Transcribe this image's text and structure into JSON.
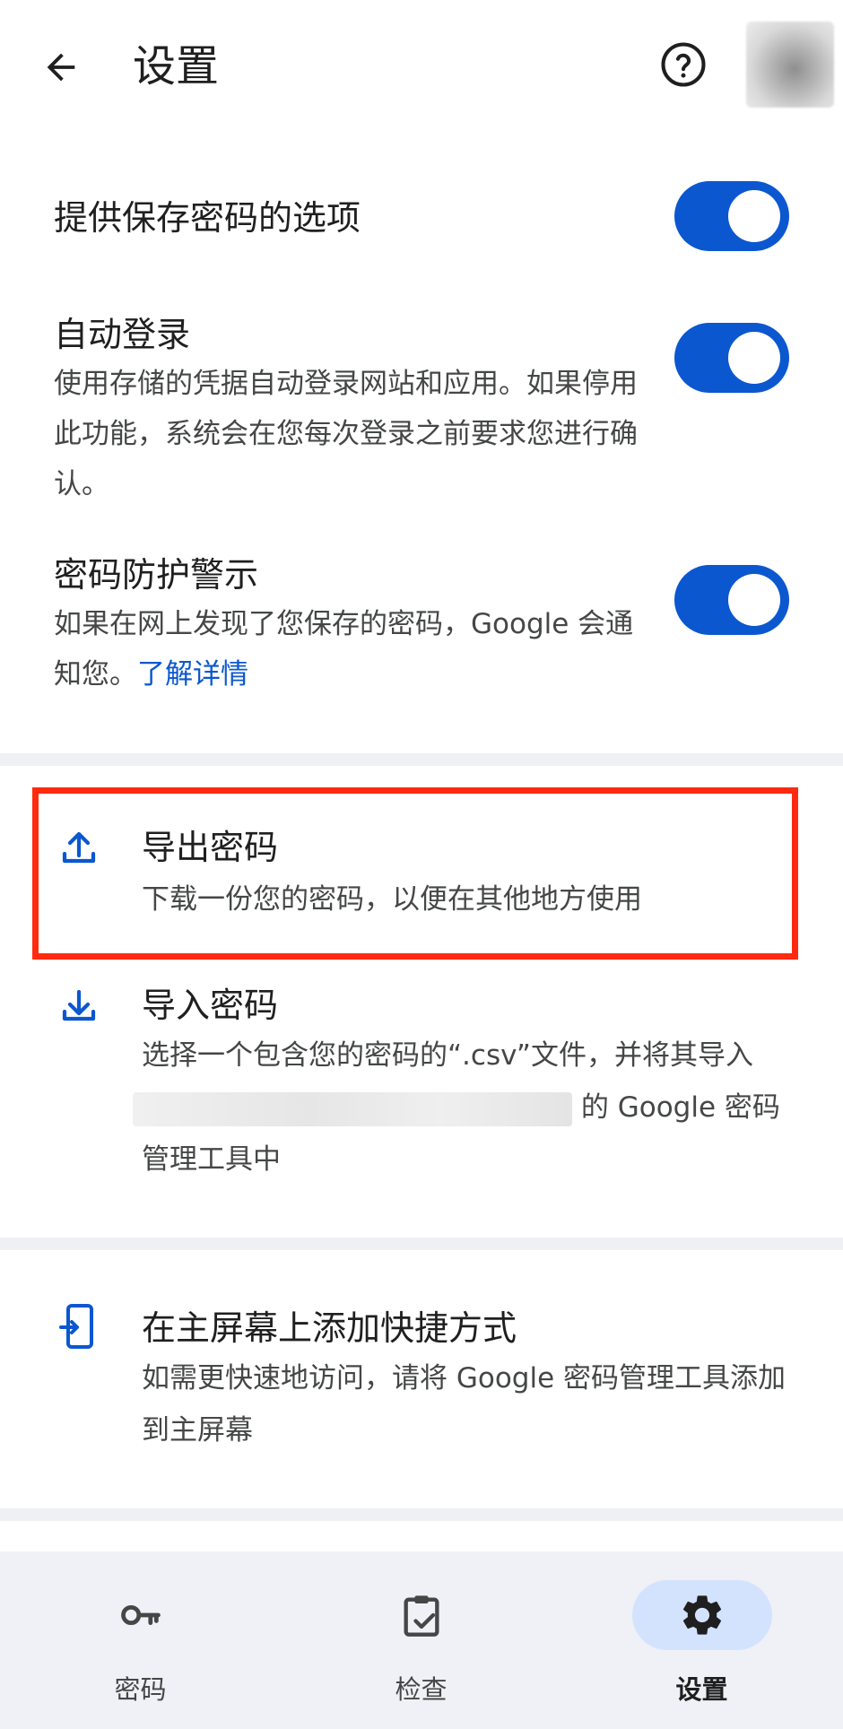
{
  "header": {
    "title": "设置",
    "back_icon": "arrow-back-icon",
    "help_icon": "help-circle-icon"
  },
  "settings": [
    {
      "title": "提供保存密码的选项",
      "enabled": true
    },
    {
      "title": "自动登录",
      "description": "使用存储的凭据自动登录网站和应用。如果停用此功能，系统会在您每次登录之前要求您进行确认。",
      "enabled": true
    },
    {
      "title": "密码防护警示",
      "description": "如果在网上发现了您保存的密码，Google 会通知您。",
      "link": "了解详情",
      "enabled": true
    }
  ],
  "actions": {
    "export": {
      "title": "导出密码",
      "description": "下载一份您的密码，以便在其他地方使用",
      "icon": "upload-icon"
    },
    "import": {
      "title": "导入密码",
      "description_before": "选择一个包含您的密码的“.csv”文件，并将其导入",
      "description_after": "的 Google 密码管理工具中",
      "icon": "download-icon"
    },
    "shortcut": {
      "title": "在主屏幕上添加快捷方式",
      "description": "如需更快速地访问，请将 Google 密码管理工具添加到主屏幕",
      "icon": "add-to-home-screen-icon"
    }
  },
  "bottom_nav": [
    {
      "label": "密码",
      "icon": "key-icon",
      "active": false
    },
    {
      "label": "检查",
      "icon": "clipboard-check-icon",
      "active": false
    },
    {
      "label": "设置",
      "icon": "gear-icon",
      "active": true
    }
  ],
  "colors": {
    "accent": "#0b57d0",
    "highlight_border": "#ff2a0f",
    "nav_active_bg": "#d3e3fd"
  }
}
